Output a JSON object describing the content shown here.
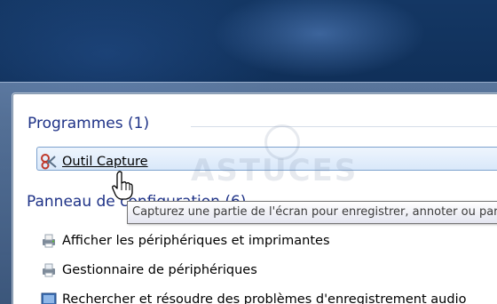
{
  "programs": {
    "title": "Programmes (1)",
    "items": [
      {
        "label": "Outil Capture",
        "icon": "snipping-tool-icon"
      }
    ]
  },
  "control_panel": {
    "title": "Panneau de configuration (6)",
    "items": [
      {
        "label": "Afficher les périphériques et imprimantes",
        "icon": "printer-devices-icon"
      },
      {
        "label": "Gestionnaire de périphériques",
        "icon": "device-manager-icon"
      },
      {
        "label": "Rechercher et résoudre des problèmes d'enregistrement audio",
        "icon": "troubleshoot-audio-icon"
      }
    ]
  },
  "tooltip": {
    "text": "Capturez une partie de l'écran pour enregistrer, annoter ou partager l'image."
  },
  "watermark": {
    "text": "ASTUCES"
  },
  "colors": {
    "section_title": "#1e3287",
    "selection_border": "#7da2ce",
    "selection_fill": "#d9e8fa"
  }
}
